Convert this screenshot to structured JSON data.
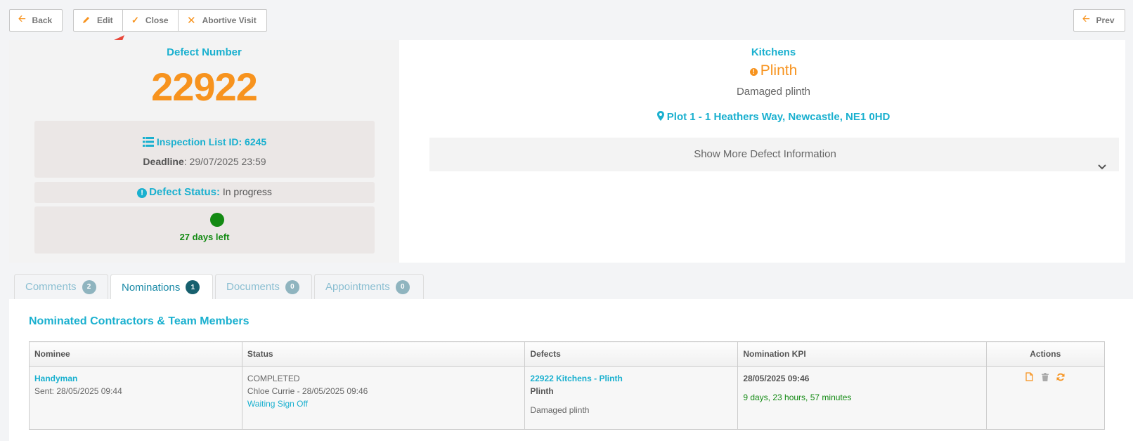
{
  "toolbar": {
    "back": "Back",
    "edit": "Edit",
    "close": "Close",
    "abortive": "Abortive Visit",
    "prev": "Prev"
  },
  "defect": {
    "number_label": "Defect Number",
    "number": "22922",
    "inspection": "Inspection List ID: 6245",
    "deadline_label": "Deadline",
    "deadline_value": ": 29/07/2025 23:59",
    "status_label": "Defect Status:",
    "status_value": "In progress",
    "days_left": "27 days left",
    "days_left_color": "#138a13"
  },
  "detail": {
    "category": "Kitchens",
    "subcategory": "Plinth",
    "description": "Damaged plinth",
    "location": "Plot 1 - 1 Heathers Way, Newcastle, NE1 0HD",
    "show_more": "Show More Defect Information"
  },
  "tabs": [
    {
      "label": "Comments",
      "count": "2"
    },
    {
      "label": "Nominations",
      "count": "1"
    },
    {
      "label": "Documents",
      "count": "0"
    },
    {
      "label": "Appointments",
      "count": "0"
    }
  ],
  "nominations": {
    "title": "Nominated Contractors & Team Members",
    "headers": [
      "Nominee",
      "Status",
      "Defects",
      "Nomination KPI",
      "Actions"
    ],
    "row": {
      "nominee": "Handyman",
      "sent": "Sent: 28/05/2025 09:44",
      "status": "COMPLETED",
      "status_by": "Chloe Currie - 28/05/2025 09:46",
      "status_link": "Waiting Sign Off",
      "defect_link": "22922 Kitchens - Plinth",
      "defect_sub": "Plinth",
      "defect_desc": "Damaged plinth",
      "kpi_date": "28/05/2025 09:46",
      "kpi_duration": "9 days, 23 hours, 57 minutes"
    }
  },
  "colors": {
    "accent": "#f7931e",
    "link": "#1ab0cf",
    "success": "#138a13"
  }
}
